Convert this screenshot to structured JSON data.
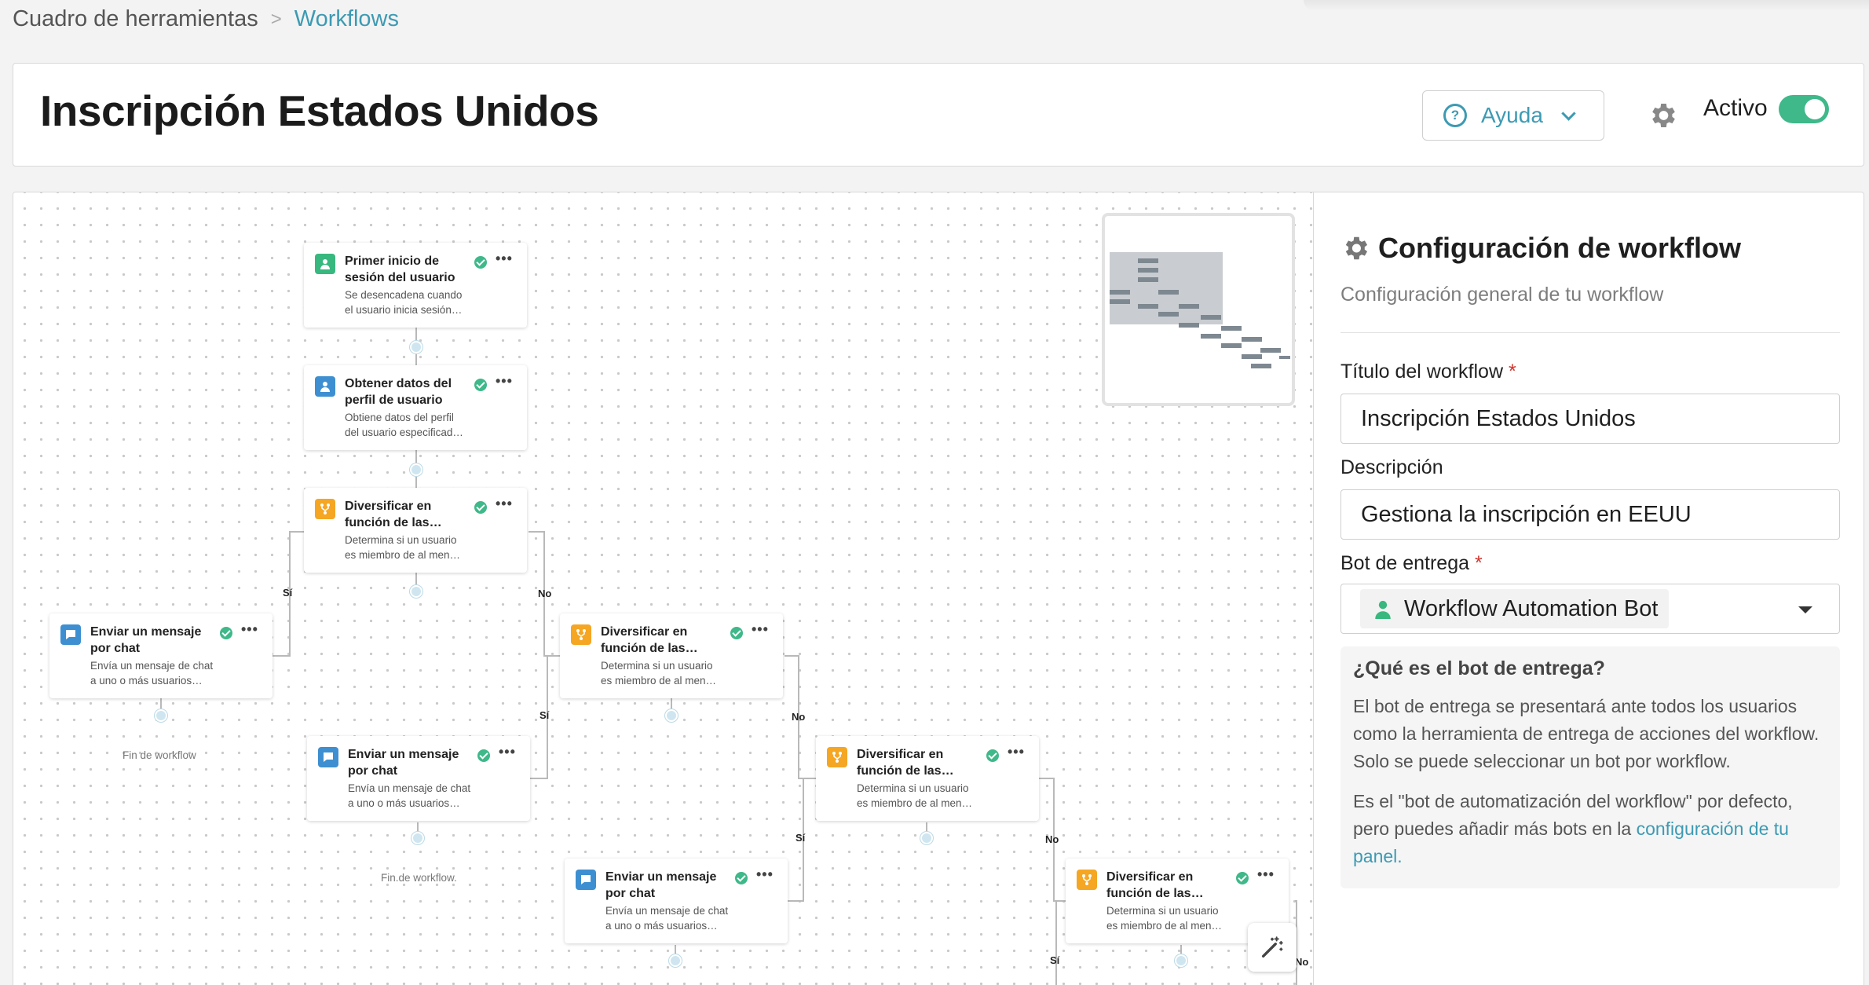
{
  "breadcrumb": {
    "root": "Cuadro de herramientas",
    "separator": ">",
    "current": "Workflows"
  },
  "header": {
    "title": "Inscripción Estados Unidos",
    "help_label": "Ayuda",
    "active_label": "Activo",
    "active": true
  },
  "canvas": {
    "nodes": [
      {
        "id": "n1",
        "icon": "user-icon",
        "title_line1": "Primer inicio de",
        "title_line2": "sesión del usuario",
        "desc_line1": "Se desencadena cuando",
        "desc_line2": "el usuario inicia sesión…"
      },
      {
        "id": "n2",
        "icon": "profile-icon",
        "title_line1": "Obtener datos del",
        "title_line2": "perfil de usuario",
        "desc_line1": "Obtiene datos del perfil",
        "desc_line2": "del usuario especificad…"
      },
      {
        "id": "n3",
        "icon": "branch-icon",
        "title_line1": "Diversificar en",
        "title_line2": "función de las…",
        "desc_line1": "Determina si un usuario",
        "desc_line2": "es miembro de al men…"
      },
      {
        "id": "n4",
        "icon": "chat-icon",
        "title_line1": "Enviar un mensaje",
        "title_line2": "por chat",
        "desc_line1": "Envía un mensaje de chat",
        "desc_line2": "a uno o más usuarios…"
      },
      {
        "id": "n5",
        "icon": "branch-icon",
        "title_line1": "Diversificar en",
        "title_line2": "función de las…",
        "desc_line1": "Determina si un usuario",
        "desc_line2": "es miembro de al men…"
      },
      {
        "id": "n6",
        "icon": "chat-icon",
        "title_line1": "Enviar un mensaje",
        "title_line2": "por chat",
        "desc_line1": "Envía un mensaje de chat",
        "desc_line2": "a uno o más usuarios…"
      },
      {
        "id": "n7",
        "icon": "branch-icon",
        "title_line1": "Diversificar en",
        "title_line2": "función de las…",
        "desc_line1": "Determina si un usuario",
        "desc_line2": "es miembro de al men…"
      },
      {
        "id": "n8",
        "icon": "chat-icon",
        "title_line1": "Enviar un mensaje",
        "title_line2": "por chat",
        "desc_line1": "Envía un mensaje de chat",
        "desc_line2": "a uno o más usuarios…"
      },
      {
        "id": "n9",
        "icon": "branch-icon",
        "title_line1": "Diversificar en",
        "title_line2": "función de las…",
        "desc_line1": "Determina si un usuario",
        "desc_line2": "es miembro de al men…"
      }
    ],
    "labels": {
      "yes": "Sí",
      "no": "No",
      "no_cut": "No",
      "end_1": "Fin de workflow",
      "end_2": "Fin.de workflow."
    }
  },
  "sidebar": {
    "title": "Configuración de workflow",
    "subtitle": "Configuración general de tu workflow",
    "title_label": "Título del workflow",
    "title_value": "Inscripción Estados Unidos",
    "desc_label": "Descripción",
    "desc_value": "Gestiona la inscripción en EEUU",
    "bot_label": "Bot de entrega",
    "bot_value": "Workflow Automation Bot",
    "required_mark": "*",
    "info": {
      "title": "¿Qué es el bot de entrega?",
      "p1": "El bot de entrega se presentará ante todos los usuarios como la herramienta de entrega de acciones del workflow. Solo se puede seleccionar un bot por workflow.",
      "p2_before": "Es el \"bot de automatización del workflow\" por defecto, pero puedes añadir más bots en la ",
      "p2_link": "configuración de tu panel."
    }
  },
  "colors": {
    "accent": "#3d9ab3",
    "toggle_on": "#3fb88a",
    "branch": "#f5a623",
    "chat": "#3d8fd1",
    "user": "#38b87f"
  }
}
